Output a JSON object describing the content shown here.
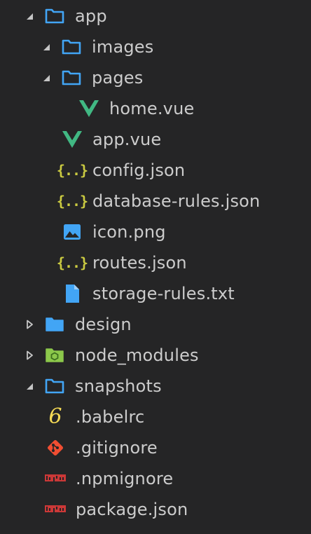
{
  "explorer": {
    "items": [
      {
        "label": "app",
        "icon": "folder-open-icon",
        "twisty": "expanded"
      },
      {
        "label": "images",
        "icon": "folder-open-icon",
        "twisty": "expanded"
      },
      {
        "label": "pages",
        "icon": "folder-open-icon",
        "twisty": "expanded"
      },
      {
        "label": "home.vue",
        "icon": "vue-icon",
        "twisty": "none"
      },
      {
        "label": "app.vue",
        "icon": "vue-icon",
        "twisty": "none"
      },
      {
        "label": "config.json",
        "icon": "json-icon",
        "twisty": "none"
      },
      {
        "label": "database-rules.json",
        "icon": "json-icon",
        "twisty": "none"
      },
      {
        "label": "icon.png",
        "icon": "image-icon",
        "twisty": "none"
      },
      {
        "label": "routes.json",
        "icon": "json-icon",
        "twisty": "none"
      },
      {
        "label": "storage-rules.txt",
        "icon": "file-icon",
        "twisty": "none"
      },
      {
        "label": "design",
        "icon": "folder-closed-icon",
        "twisty": "collapsed"
      },
      {
        "label": "node_modules",
        "icon": "node-modules-icon",
        "twisty": "collapsed"
      },
      {
        "label": "snapshots",
        "icon": "folder-open-icon",
        "twisty": "expanded"
      },
      {
        "label": ".babelrc",
        "icon": "babel-icon",
        "twisty": "none"
      },
      {
        "label": ".gitignore",
        "icon": "git-icon",
        "twisty": "none"
      },
      {
        "label": ".npmignore",
        "icon": "npm-icon",
        "twisty": "none"
      },
      {
        "label": "package.json",
        "icon": "npm-icon",
        "twisty": "none"
      }
    ]
  },
  "colors": {
    "background": "#252526",
    "text": "#cccccc",
    "folder": "#42a5f5",
    "vue": "#41b883",
    "json": "#cbcb41",
    "git": "#f14e32",
    "npm": "#cb3837",
    "node": "#8cc84b",
    "babel": "#f5da55"
  }
}
